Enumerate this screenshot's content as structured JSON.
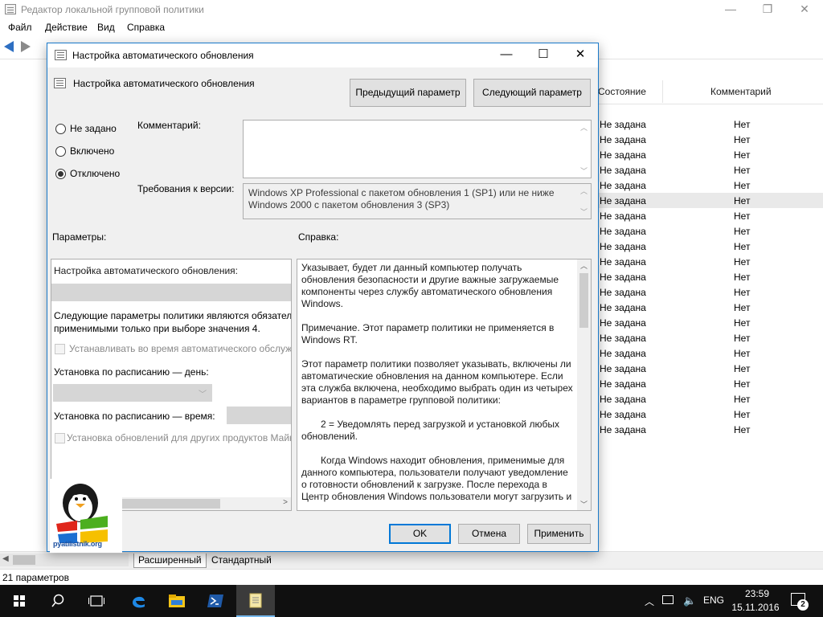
{
  "main_window": {
    "title": "Редактор локальной групповой политики",
    "controls": {
      "minimize": "—",
      "maximize": "❐",
      "close": "✕"
    },
    "menu": [
      "Файл",
      "Действие",
      "Вид",
      "Справка"
    ],
    "list": {
      "columns": {
        "state": "Состояние",
        "comment": "Комментарий"
      },
      "rows": [
        {
          "state": "Не задана",
          "comment": "Нет"
        },
        {
          "state": "Не задана",
          "comment": "Нет"
        },
        {
          "state": "Не задана",
          "comment": "Нет"
        },
        {
          "state": "Не задана",
          "comment": "Нет"
        },
        {
          "state": "Не задана",
          "comment": "Нет"
        },
        {
          "state": "Не задана",
          "comment": "Нет",
          "selected": true
        },
        {
          "state": "Не задана",
          "comment": "Нет"
        },
        {
          "state": "Не задана",
          "comment": "Нет"
        },
        {
          "state": "Не задана",
          "comment": "Нет"
        },
        {
          "state": "Не задана",
          "comment": "Нет"
        },
        {
          "state": "Не задана",
          "comment": "Нет"
        },
        {
          "state": "Не задана",
          "comment": "Нет"
        },
        {
          "state": "Не задана",
          "comment": "Нет"
        },
        {
          "state": "Не задана",
          "comment": "Нет"
        },
        {
          "state": "Не задана",
          "comment": "Нет"
        },
        {
          "state": "Не задана",
          "comment": "Нет"
        },
        {
          "state": "Не задана",
          "comment": "Нет"
        },
        {
          "state": "Не задана",
          "comment": "Нет"
        },
        {
          "state": "Не задана",
          "comment": "Нет"
        },
        {
          "state": "Не задана",
          "comment": "Нет"
        },
        {
          "state": "Не задана",
          "comment": "Нет"
        }
      ]
    },
    "tabs": {
      "extended": "Расширенный",
      "standard": "Стандартный"
    },
    "status": "21 параметров"
  },
  "dialog": {
    "title": "Настройка автоматического обновления",
    "header": "Настройка автоматического обновления",
    "controls": {
      "minimize": "—",
      "maximize": "☐",
      "close": "✕"
    },
    "prev_button": "Предыдущий параметр",
    "next_button": "Следующий параметр",
    "radios": [
      {
        "label": "Не задано",
        "checked": false
      },
      {
        "label": "Включено",
        "checked": false
      },
      {
        "label": "Отключено",
        "checked": true
      }
    ],
    "comment_label": "Комментарий:",
    "comment_value": "",
    "requirements_label": "Требования к версии:",
    "requirements_text": "Windows XP Professional с пакетом обновления 1 (SP1) или не ниже Windows 2000 с пакетом обновления 3 (SP3)",
    "params_label": "Параметры:",
    "help_label": "Справка:",
    "params": {
      "heading": "Настройка автоматического обновления:",
      "note_line1": "Следующие параметры политики являются обязатель",
      "note_line2": "применимыми только при выборе значения 4.",
      "check1_label": "Устанавливать во время автоматического обслужи",
      "day_label": "Установка по расписанию — день:",
      "time_label": "Установка по расписанию — время:",
      "check2_label": "Установка обновлений для других продуктов Майк"
    },
    "help_paragraphs": [
      {
        "text": "Указывает, будет ли данный компьютер получать обновления безопасности и другие важные загружаемые компоненты через службу автоматического обновления Windows.",
        "indent": false
      },
      {
        "text": "Примечание. Этот параметр политики не применяется в Windows RT.",
        "indent": false
      },
      {
        "text": "Этот параметр политики позволяет указывать, включены ли автоматические обновления на данном компьютере. Если эта служба включена, необходимо выбрать один из четырех вариантов в параметре групповой политики:",
        "indent": false
      },
      {
        "text": "2 = Уведомлять перед загрузкой и установкой любых обновлений.",
        "indent": true
      },
      {
        "text": "Когда Windows находит обновления, применимые для данного компьютера, пользователи получают уведомление о готовности обновлений к загрузке. После перехода в Центр обновления Windows пользователи могут загрузить и",
        "indent": true
      }
    ],
    "ok_button": "OK",
    "cancel_button": "Отмена",
    "apply_button": "Применить"
  },
  "watermark": {
    "text": "pyatilistnik.org"
  },
  "taskbar": {
    "language": "ENG",
    "time": "23:59",
    "date": "15.11.2016",
    "notifications_count": "2",
    "pinned": [
      "start-icon",
      "search-icon",
      "task-view-icon",
      "edge-icon",
      "file-explorer-icon",
      "powershell-icon",
      "notepad-icon"
    ]
  },
  "colors": {
    "accent": "#0078d7",
    "dialog_border": "#1979ca",
    "taskbar": "#101010"
  }
}
